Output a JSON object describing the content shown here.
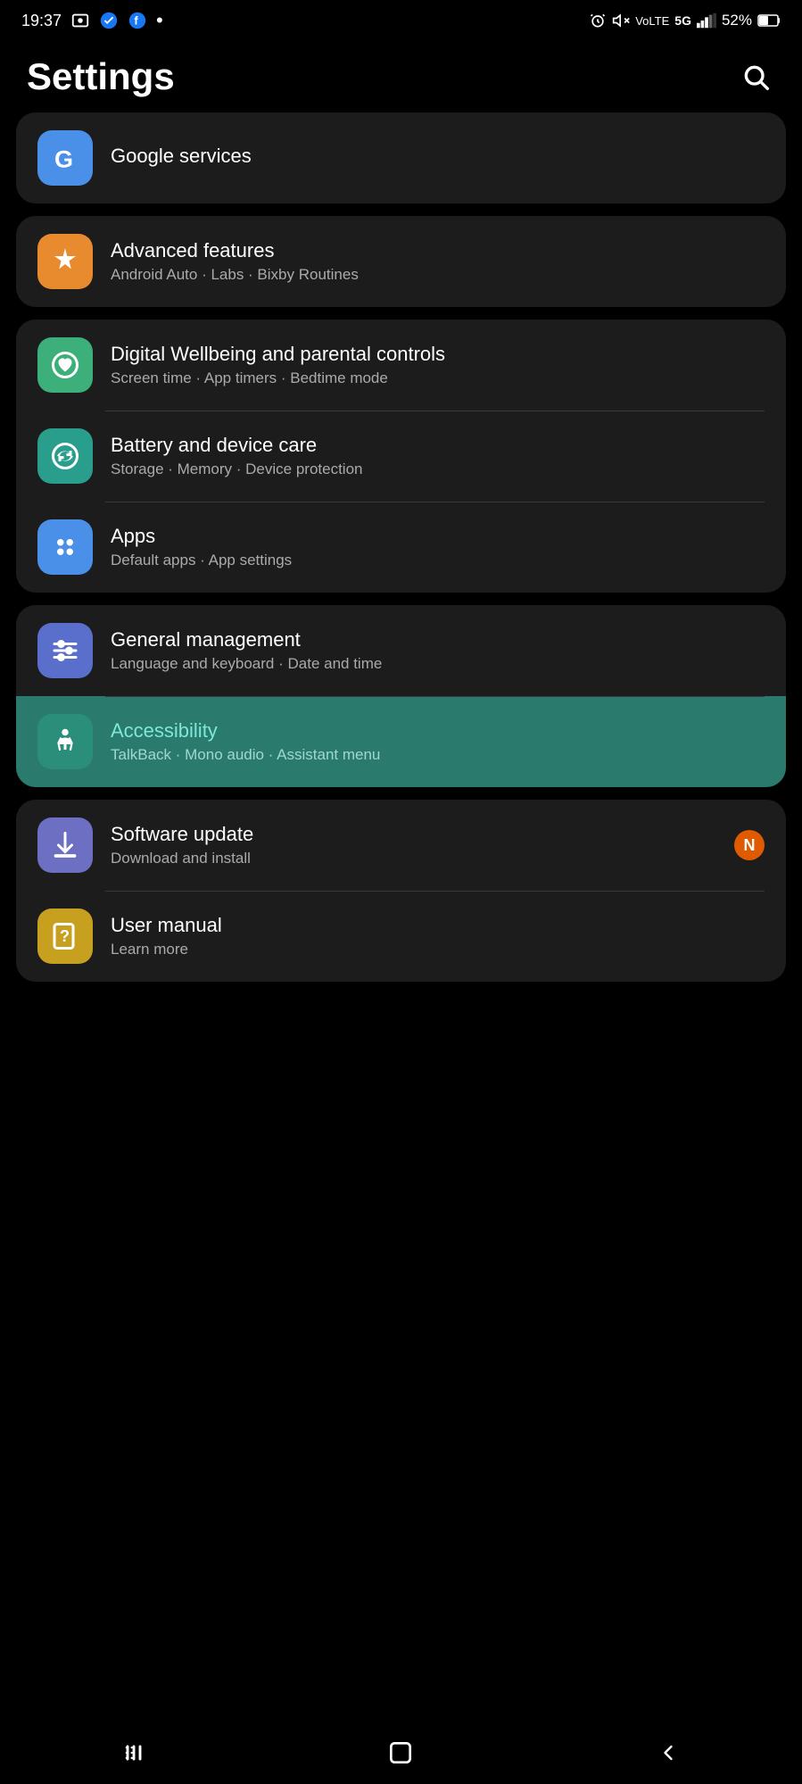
{
  "statusBar": {
    "time": "19:37",
    "battery": "52%"
  },
  "header": {
    "title": "Settings",
    "searchAriaLabel": "Search settings"
  },
  "settingsGroups": [
    {
      "id": "group-google",
      "items": [
        {
          "id": "google-services",
          "title": "Google services",
          "subtitle": "",
          "iconColor": "icon-blue",
          "iconSymbol": "G",
          "highlighted": false
        }
      ]
    },
    {
      "id": "group-advanced",
      "items": [
        {
          "id": "advanced-features",
          "title": "Advanced features",
          "subtitle": "Android Auto · Labs · Bixby Routines",
          "iconColor": "icon-orange",
          "iconSymbol": "⚙",
          "highlighted": false
        }
      ]
    },
    {
      "id": "group-wellbeing",
      "items": [
        {
          "id": "digital-wellbeing",
          "title": "Digital Wellbeing and parental controls",
          "subtitle": "Screen time · App timers · Bedtime mode",
          "iconColor": "icon-green",
          "iconSymbol": "♡",
          "highlighted": false
        },
        {
          "id": "battery-care",
          "title": "Battery and device care",
          "subtitle": "Storage · Memory · Device protection",
          "iconColor": "icon-teal",
          "iconSymbol": "↻",
          "highlighted": false
        },
        {
          "id": "apps",
          "title": "Apps",
          "subtitle": "Default apps · App settings",
          "iconColor": "icon-blue",
          "iconSymbol": "⊞",
          "highlighted": false
        }
      ]
    },
    {
      "id": "group-general",
      "items": [
        {
          "id": "general-management",
          "title": "General management",
          "subtitle": "Language and keyboard · Date and time",
          "iconColor": "icon-purple-blue",
          "iconSymbol": "≡",
          "highlighted": false
        },
        {
          "id": "accessibility",
          "title": "Accessibility",
          "subtitle": "TalkBack · Mono audio · Assistant menu",
          "iconColor": "icon-accessibility",
          "iconSymbol": "♿",
          "highlighted": true
        }
      ]
    },
    {
      "id": "group-software",
      "items": [
        {
          "id": "software-update",
          "title": "Software update",
          "subtitle": "Download and install",
          "iconColor": "icon-purple",
          "iconSymbol": "↓",
          "highlighted": false,
          "badge": "N"
        },
        {
          "id": "user-manual",
          "title": "User manual",
          "subtitle": "Learn more",
          "iconColor": "icon-yellow",
          "iconSymbol": "?",
          "highlighted": false
        }
      ]
    }
  ],
  "navBar": {
    "recentLabel": "Recent apps",
    "homeLabel": "Home",
    "backLabel": "Back"
  }
}
